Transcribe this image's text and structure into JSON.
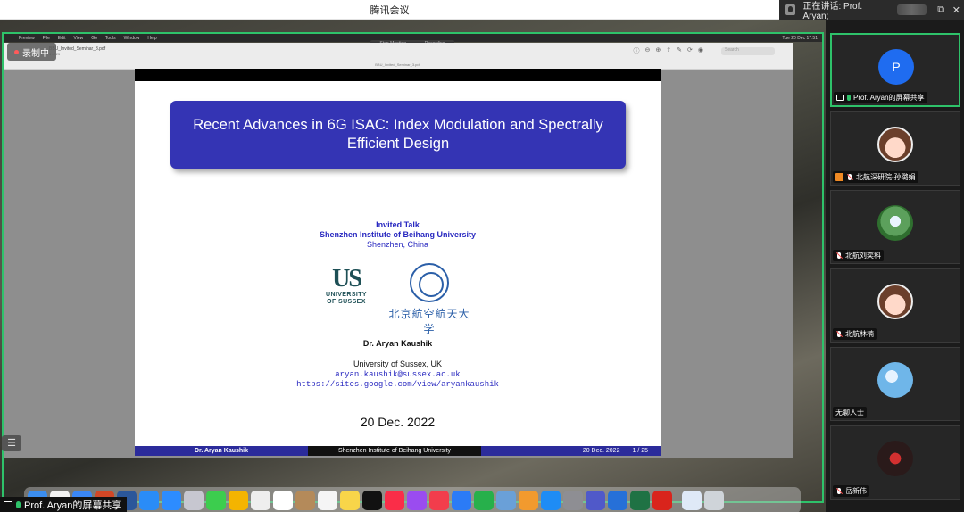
{
  "app": {
    "window_title": "腾讯会议"
  },
  "speaker": {
    "label": "正在讲话: Prof. Aryan;",
    "restore_glyph": "⧉",
    "close_glyph": "✕"
  },
  "recording": {
    "badge": "录制中",
    "pill_left": "Stop Meeting",
    "pill_right": "Recording"
  },
  "mac_menu": [
    "Preview",
    "File",
    "Edit",
    "View",
    "Go",
    "Tools",
    "Window",
    "Help"
  ],
  "mac_clock": "Tue 20 Dec 17:51",
  "preview": {
    "filename": "BBU_Invited_Seminar_3.pdf",
    "page_count": "1 of 25",
    "center_title": "BBU_Invited_Seminar_3.pdf",
    "search_placeholder": "Search"
  },
  "slide": {
    "title": "Recent Advances in 6G ISAC: Index Modulation and Spectrally\nEfficient Design",
    "invited": "Invited Talk",
    "institute": "Shenzhen Institute of Beihang University",
    "location": "Shenzhen, China",
    "us_logo_text": "US",
    "us_logo_sub1": "UNIVERSITY",
    "us_logo_sub2": "OF SUSSEX",
    "bh_logo_text": "北京航空航天大学",
    "speaker_name": "Dr. Aryan Kaushik",
    "affiliation": "University of Sussex, UK",
    "email": "aryan.kaushik@sussex.ac.uk",
    "website": "https://sites.google.com/view/aryankaushik",
    "date": "20 Dec. 2022",
    "footer_left": "Dr. Aryan Kaushik",
    "footer_mid": "Shenzhen Institute of Beihang University",
    "footer_date": "20 Dec. 2022",
    "footer_page": "1 / 25"
  },
  "share_label": "Prof. Aryan的屏幕共享",
  "participants": [
    {
      "avatar_text": "P",
      "name": "Prof. Aryan的屏幕共享",
      "mic": "active",
      "role": "sharing"
    },
    {
      "avatar_text": "",
      "name": "北航深研院-孙璐娟",
      "mic": "muted",
      "role": "host"
    },
    {
      "avatar_text": "",
      "name": "北航刘奕科",
      "mic": "muted",
      "role": ""
    },
    {
      "avatar_text": "",
      "name": "北航林楠",
      "mic": "muted",
      "role": ""
    },
    {
      "avatar_text": "",
      "name": "无聊人士",
      "mic": "none",
      "role": ""
    },
    {
      "avatar_text": "",
      "name": "岳新伟",
      "mic": "muted",
      "role": ""
    }
  ],
  "dock_apps": [
    "finder-icon",
    "chrome-icon",
    "mail-icon",
    "powerpoint-icon",
    "word-icon",
    "safari-icon",
    "zoom-icon",
    "launchpad-icon",
    "messages-icon",
    "photos-icon",
    "photos2-icon",
    "calendar-icon",
    "contacts-icon",
    "reminders-icon",
    "notes-icon",
    "appletv-icon",
    "music-icon",
    "podcasts-icon",
    "news-icon",
    "keynote-icon",
    "numbers-icon",
    "preview-icon",
    "pages-icon",
    "appstore-icon",
    "settings-icon",
    "teams-icon",
    "onedrive-icon",
    "excel-icon",
    "acrobat-icon",
    "downloads-icon",
    "trash-icon"
  ],
  "dock_colors": [
    "#3b8ef0",
    "#f2f2f2",
    "#3a86f5",
    "#d24726",
    "#2b579a",
    "#2a8cf7",
    "#2d8cff",
    "#c7c7d0",
    "#3ccd4e",
    "#f4b400",
    "#eeeeee",
    "#ffffff",
    "#b48a5a",
    "#f5f5f5",
    "#f8d549",
    "#111111",
    "#fa2d48",
    "#9a4cf0",
    "#f23d4c",
    "#2b7bf6",
    "#27b04b",
    "#6aa0d8",
    "#f29a2e",
    "#1e8cf5",
    "#8e8e93",
    "#5059c9",
    "#2670d8",
    "#1f7244",
    "#d9241c",
    "#dfe9f7",
    "#cfd4d9"
  ]
}
